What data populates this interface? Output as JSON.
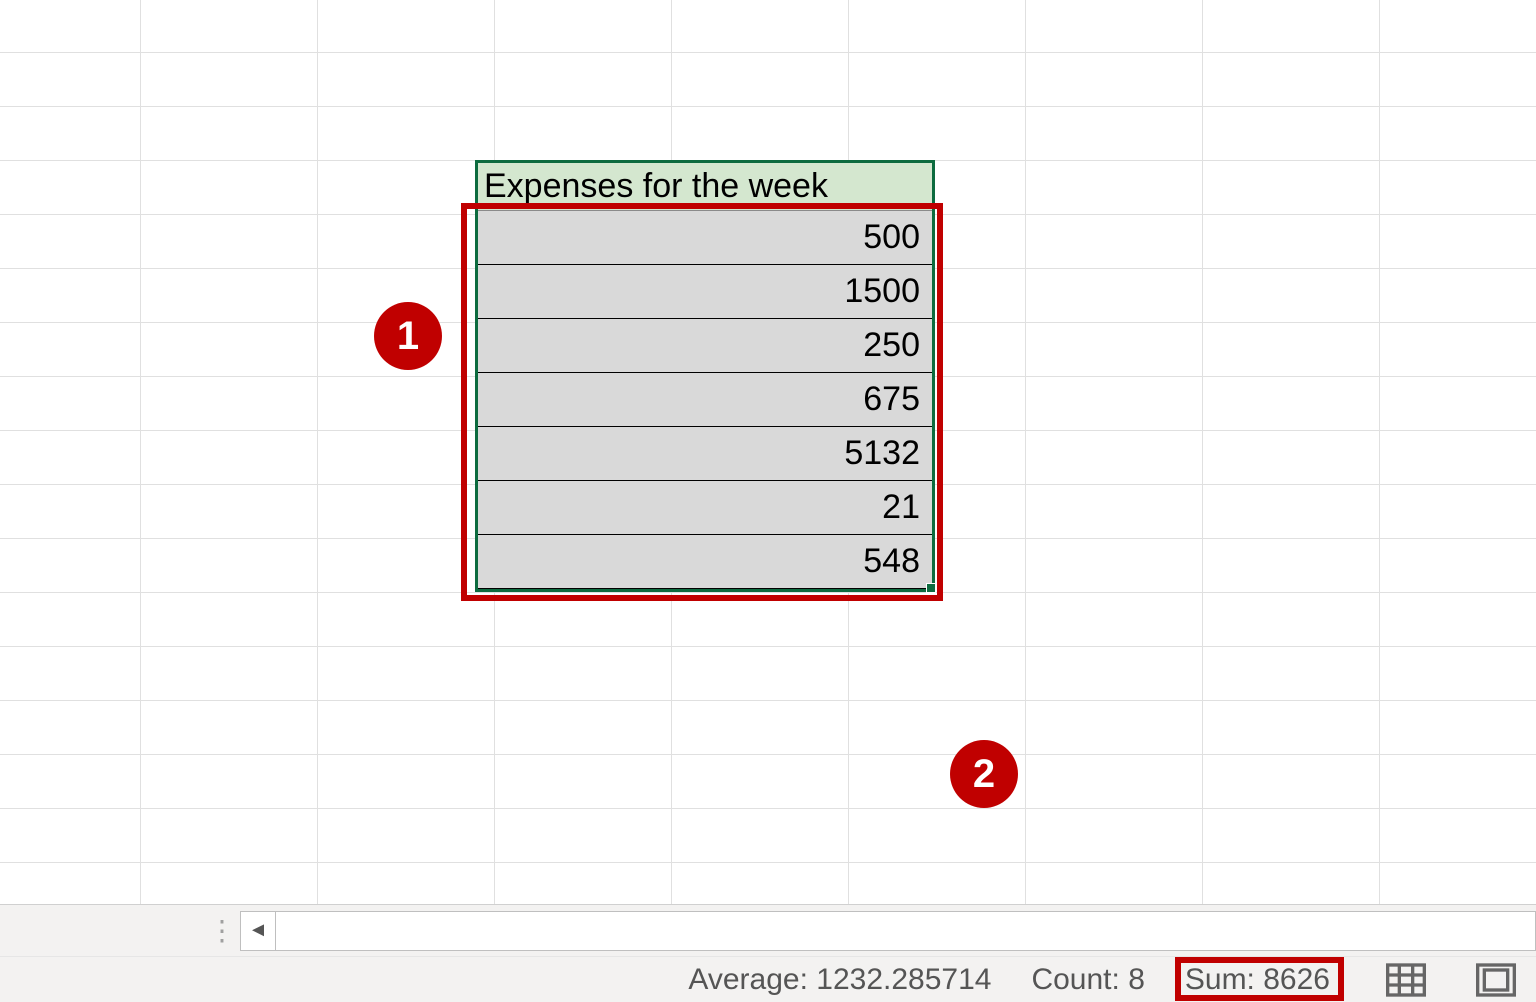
{
  "grid": {
    "header": "Expenses for the week",
    "values": [
      "500",
      "1500",
      "250",
      "675",
      "5132",
      "21",
      "548"
    ]
  },
  "annotations": {
    "callout1": "1",
    "callout2": "2"
  },
  "statusbar": {
    "average_label": "Average:",
    "average_value": "1232.285714",
    "count_label": "Count:",
    "count_value": "8",
    "sum_label": "Sum:",
    "sum_value": "8626"
  }
}
